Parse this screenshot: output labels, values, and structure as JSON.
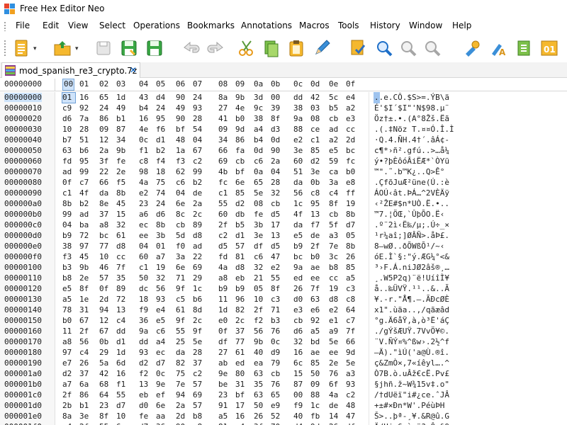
{
  "app": {
    "title": "Free Hex Editor Neo"
  },
  "menu": [
    "File",
    "Edit",
    "View",
    "Select",
    "Operations",
    "Bookmarks",
    "Annotations",
    "Macros",
    "Tools",
    "History",
    "Window",
    "Help"
  ],
  "toolbar": {
    "icons": [
      "new-file-icon",
      "open-folder-icon",
      "blank-document-icon",
      "save-icon",
      "save-all-icon",
      "undo-icon",
      "redo-icon",
      "cut-icon",
      "copy-icon",
      "paste-icon",
      "pencil-icon",
      "find-icon",
      "search-icon",
      "search-next-icon",
      "search-previous-icon",
      "settings-icon",
      "rename-icon",
      "binary-icon"
    ],
    "binary_label": "01"
  },
  "tab": {
    "label": "mod_spanish_re3_crypto.7z",
    "close": "✕"
  },
  "header": {
    "offset_label": "00000000",
    "columns": [
      "00",
      "01",
      "02",
      "03",
      "04",
      "05",
      "06",
      "07",
      "08",
      "09",
      "0a",
      "0b",
      "0c",
      "0d",
      "0e",
      "0f"
    ]
  },
  "rows": [
    {
      "off": "00000000",
      "bytes": "01 16 65 1d 43 d4 90 24 8a 9b 3d 00 dd 42 5c e4",
      "ascii": "..e.CÔ.$S>=.ÝB\\ä"
    },
    {
      "off": "00000010",
      "bytes": "c9 92 24 49 b4 24 49 93 27 4e 9c 39 38 03 b5 a2",
      "ascii": "É'$I´$I\"'N$98.µ¨"
    },
    {
      "off": "00000020",
      "bytes": "d6 7a 86 b1 16 95 90 28 41 b0 38 8f 9a 08 cb e3",
      "ascii": "Öz†±.•.(A°8Žš.Ëã"
    },
    {
      "off": "00000030",
      "bytes": "10 28 09 87 4e f6 bf 54 09 9d a4 d3 88 ce ad cc",
      "ascii": ".(.‡Nöz T.¤¤Ó.Î.Ì"
    },
    {
      "off": "00000040",
      "bytes": "b7 51 12 34 0c d1 48 04 34 86 b4 0d e2 c1 a2 2d",
      "ascii": "·Q.4.ÑH.4†´.âÁ¢-"
    },
    {
      "off": "00000050",
      "bytes": "63 b6 2a 9b f1 b2 1a 67 66 fa 0d 90 3e 85 e5 bc",
      "ascii": "c¶*›ñ².gfú..>…å¼"
    },
    {
      "off": "00000060",
      "bytes": "fd 95 3f fe c8 f4 f3 c2 69 cb c6 2a 60 d2 59 fc",
      "ascii": "ý•?þÈôóÂiËÆ*`ÒYü"
    },
    {
      "off": "00000070",
      "bytes": "ad 99 22 2e 98 18 62 99 4b bf 0a 04 51 3e ca b0",
      "ascii": "­™\".˜.b™K¿..Q>Ê°"
    },
    {
      "off": "00000080",
      "bytes": "0f c7 66 f5 4a 75 c6 b2 fc 6e 65 28 da 0b 3a e8",
      "ascii": ".ÇfõJuÆ²üne(Ú.:è"
    },
    {
      "off": "00000090",
      "bytes": "c1 4f da 8b e2 74 04 de c1 85 5e 32 56 c8 c4 ff",
      "ascii": "ÁOÚ‹ât.ÞÁ…^2VÈÄÿ"
    },
    {
      "off": "000000a0",
      "bytes": "8b b2 8e 45 23 24 6e 2a 55 d2 08 cb 1c 95 8f 19",
      "ascii": "‹²ŽE#$n*UÒ.Ë.•.."
    },
    {
      "off": "000000b0",
      "bytes": "99 ad 37 15 a6 d6 8c 2c 60 db fe d5 4f 13 cb 8b",
      "ascii": "™­7.¦ÖŒ,`ÛþÕO.Ë‹"
    },
    {
      "off": "000000c0",
      "bytes": "04 ba a8 32 ec 8b cb 89 2f b5 3b 17 da f7 5f d7",
      "ascii": ".º¨2ì‹Ë‰/µ;.Ú÷_×"
    },
    {
      "off": "000000d0",
      "bytes": "b9 72 bc 61 ee 3b 5d d8 c2 d1 3e 13 e5 de a3 05",
      "ascii": "¹r¼aî;]ØÂÑ>.åÞ£."
    },
    {
      "off": "000000e0",
      "bytes": "38 97 77 d8 04 01 f0 ad d5 57 df d5 b9 2f 7e 8b",
      "ascii": "8—wØ..ð­ÕWßÕ¹/~‹"
    },
    {
      "off": "000000f0",
      "bytes": "f3 45 10 cc 60 a7 3a 22 fd 81 c6 47 bc b0 3c 26",
      "ascii": "óE.Ì`§:\"ý.ÆG¼°<&"
    },
    {
      "off": "00000100",
      "bytes": "b3 9b 46 7f c1 19 6e 69 4a d8 32 e2 9a ae b8 85",
      "ascii": "³›F.Á.niJØ2âš®¸…"
    },
    {
      "off": "00000110",
      "bytes": "b8 2e 57 35 50 32 71 29 a8 eb 21 55 ed ee cc a5",
      "ascii": "¸.W5P2q)¨ë!UíîÌ¥"
    },
    {
      "off": "00000120",
      "bytes": "e5 8f 0f 89 dc 56 9f 1c b9 b9 05 8f 26 7f 19 c3",
      "ascii": "å..‰ÜVŸ.¹¹..&..Ã"
    },
    {
      "off": "00000130",
      "bytes": "a5 1e 2d 72 18 93 c5 b6 11 96 10 c3 d0 63 d8 c8",
      "ascii": "¥.-r.\"Å¶.–.ÃÐcØÈ"
    },
    {
      "off": "00000140",
      "bytes": "78 31 94 13 f9 e4 61 8d 1d 82 2f 71 e3 e6 e2 64",
      "ascii": "x1\".ùäa..‚/qãæâd"
    },
    {
      "off": "00000150",
      "bytes": "b0 67 12 c4 36 e5 9f 2c e0 2c f2 b3 cb 92 e1 c7",
      "ascii": "°g.Ä6åŸ,à,ò³Ë'áÇ"
    },
    {
      "off": "00000160",
      "bytes": "11 2f 67 dd 9a c6 55 9f 0f 37 56 76 d6 a5 a9 7f",
      "ascii": "./gÝšÆUŸ.7VvÖ¥©."
    },
    {
      "off": "00000170",
      "bytes": "a8 56 0b d1 dd a4 25 5e df 77 9b 0c 32 bd 5e 66",
      "ascii": "¨V.ÑÝ¤%^ßw›.2½^f"
    },
    {
      "off": "00000180",
      "bytes": "97 c4 29 1d 93 ec da 28 27 61 40 d9 16 ae ee 9d",
      "ascii": "—Ä).\"ìÚ('a@Ù.®î."
    },
    {
      "off": "00000190",
      "bytes": "e7 26 5a 6d d2 d7 82 37 ab ed ea 79 6c 85 2e 5e",
      "ascii": "ç&ZmÒ×‚7«íêyl….^"
    },
    {
      "off": "000001a0",
      "bytes": "d2 37 42 16 f2 0c 75 c2 9e 80 63 cb 15 50 76 a3",
      "ascii": "Ò7B.ò.uÂž€cË.Pv£"
    },
    {
      "off": "000001b0",
      "bytes": "a7 6a 68 f1 13 9e 7e 57 be 31 35 76 87 09 6f 93",
      "ascii": "§jhñ.ž~W¾15v‡.o\""
    },
    {
      "off": "000001c0",
      "bytes": "2f 86 64 55 eb ef 94 69 23 bf 63 65 00 88 4a c2",
      "ascii": "/†dUëï\"i#¿ce.ˆJÂ"
    },
    {
      "off": "000001d0",
      "bytes": "2b b1 23 d7 d0 6e 2a 57 91 17 50 e9 f9 1c de 48",
      "ascii": "+±#×Ðn*W'.PéùÞH"
    },
    {
      "off": "000001e0",
      "bytes": "8a 3e 8f 10 fe aa 2d b8 a5 16 26 52 40 fb 14 47",
      "ascii": "Š>..þª-¸¥.&R@û.G"
    },
    {
      "off": "000001f0",
      "bytes": "c4 2f 55 6a d7 36 90 e8 81 e4 3f 70 d4 9d 26 df",
      "ascii": "Ä/Uj×6.è.ä?pÔ.&ß"
    }
  ],
  "colors": {
    "selection": "#cfe3fa",
    "selection_border": "#6e9fd6",
    "tab_close": "#0a64c8"
  }
}
